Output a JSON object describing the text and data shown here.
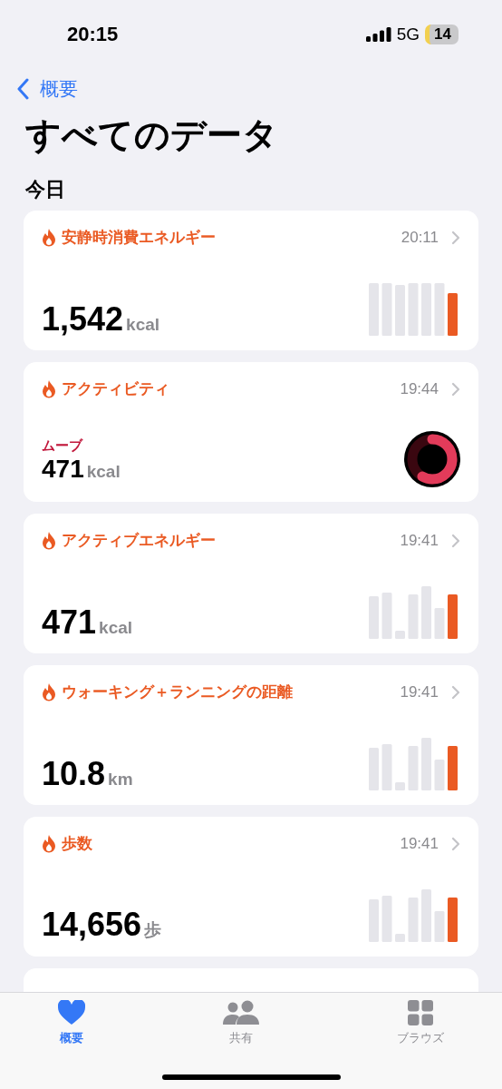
{
  "status_bar": {
    "time": "20:15",
    "network": "5G",
    "battery": "14"
  },
  "nav": {
    "back": "概要"
  },
  "title": "すべてのデータ",
  "section": "今日",
  "cards": [
    {
      "kind": "chart",
      "title": "安静時消費エネルギー",
      "time": "20:11",
      "value": "1,542",
      "unit": "kcal"
    },
    {
      "kind": "activity",
      "title": "アクティビティ",
      "time": "19:44",
      "label": "ムーブ",
      "value": "471",
      "unit": "kcal",
      "level": 0.58
    },
    {
      "kind": "chart",
      "title": "アクティブエネルギー",
      "time": "19:41",
      "value": "471",
      "unit": "kcal"
    },
    {
      "kind": "chart",
      "title": "ウォーキング＋ランニングの距離",
      "time": "19:41",
      "value": "10.8",
      "unit": "km"
    },
    {
      "kind": "chart",
      "title": "歩数",
      "time": "19:41",
      "value": "14,656",
      "unit": "歩"
    }
  ],
  "tabs": [
    {
      "label": "概要",
      "selected": true
    },
    {
      "label": "共有",
      "selected": false
    },
    {
      "label": "ブラウズ",
      "selected": false
    }
  ]
}
